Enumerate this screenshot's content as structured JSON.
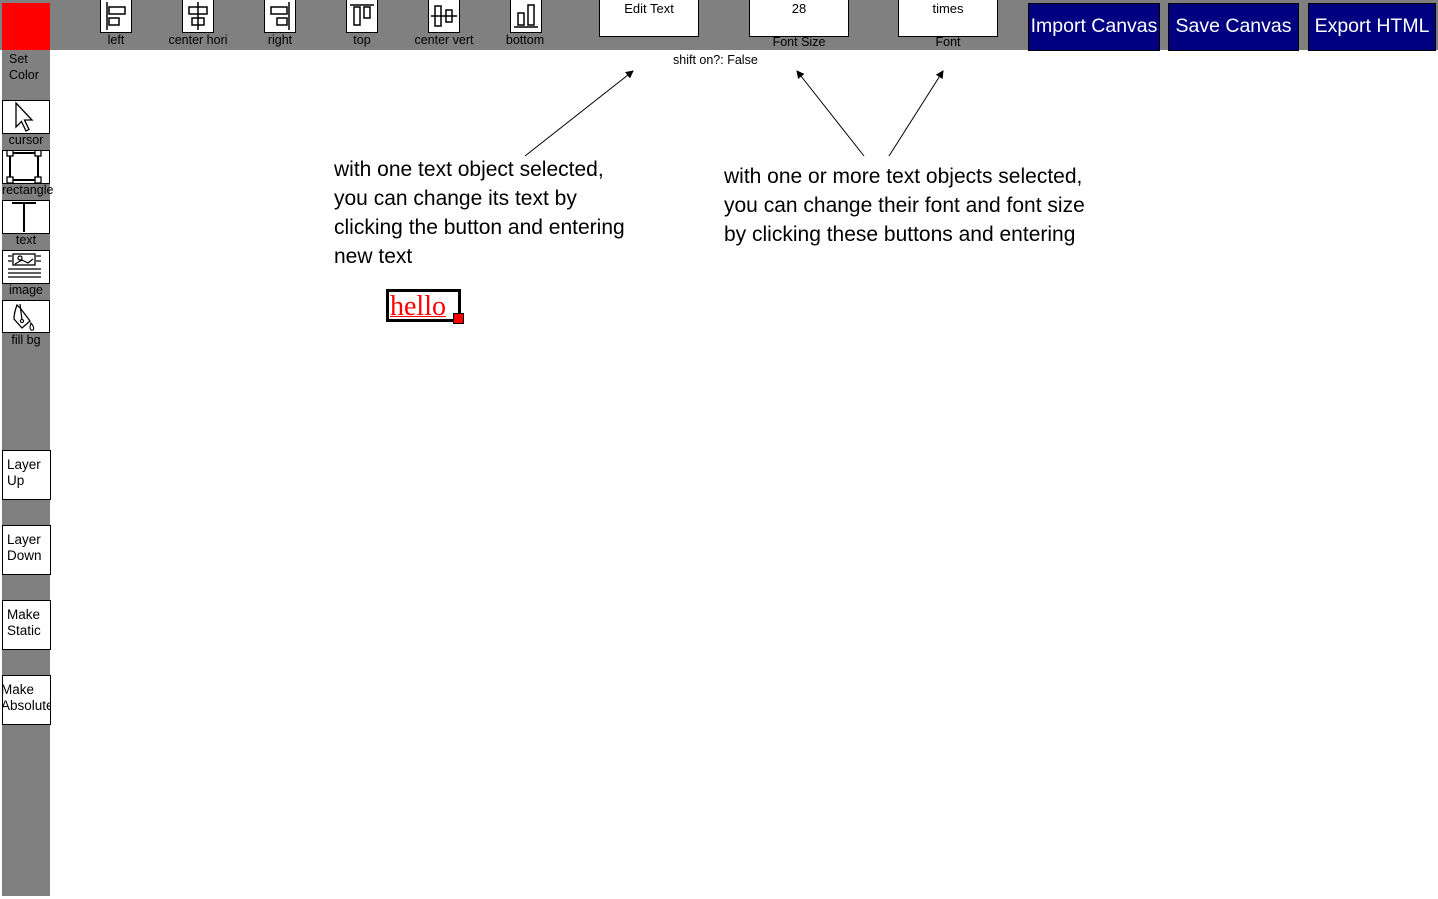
{
  "colors": {
    "toolbar_bg": "#808080",
    "current_color": "#ff0000",
    "action_button_bg": "#000080"
  },
  "sidebar": {
    "set_color": {
      "label_line1": "Set",
      "label_line2": "Color"
    },
    "tools": [
      {
        "label": "cursor",
        "icon": "cursor-arrow-icon"
      },
      {
        "label": "rectangle",
        "icon": "rectangle-icon"
      },
      {
        "label": "text",
        "icon": "text-cursor-icon"
      },
      {
        "label": "image",
        "icon": "image-icon"
      },
      {
        "label": "fill bg",
        "icon": "paint-bucket-icon"
      }
    ],
    "buttons": [
      {
        "line1": "Layer",
        "line2": "Up"
      },
      {
        "line1": "Layer",
        "line2": "Down"
      },
      {
        "line1": "Make",
        "line2": "Static"
      },
      {
        "line1": "Make",
        "line2": "Absolute"
      }
    ]
  },
  "toolbar": {
    "align": [
      {
        "label": "left",
        "icon": "align-left-icon"
      },
      {
        "label": "center hori",
        "icon": "align-center-horizontal-icon"
      },
      {
        "label": "right",
        "icon": "align-right-icon"
      },
      {
        "label": "top",
        "icon": "align-top-icon"
      },
      {
        "label": "center vert",
        "icon": "align-center-vertical-icon"
      },
      {
        "label": "bottom",
        "icon": "align-bottom-icon"
      }
    ],
    "edit_text": {
      "label": "Edit Text"
    },
    "font_size": {
      "value": "28",
      "caption": "Font Size"
    },
    "font": {
      "value": "times",
      "caption": "Font"
    },
    "actions": {
      "import": "Import Canvas",
      "save": "Save Canvas",
      "export": "Export HTML"
    }
  },
  "status": {
    "shift": "shift on?: False"
  },
  "annotations": {
    "left": [
      "with one text object selected,",
      "you can change its text by",
      "clicking the button and entering",
      "new text"
    ],
    "right": [
      "with one or more text objects selected,",
      "you can change their font and font size",
      "by clicking these buttons and entering"
    ]
  },
  "canvas": {
    "text_object": "hello"
  }
}
